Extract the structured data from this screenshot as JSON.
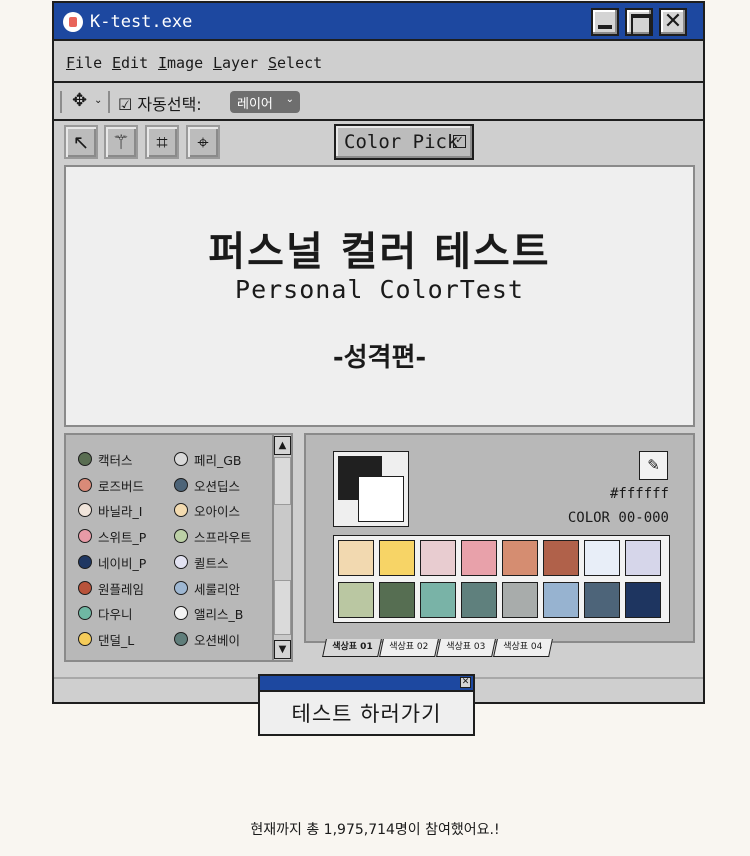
{
  "window": {
    "title": "K-test.exe",
    "close_glyph": "✕"
  },
  "menu": {
    "items": [
      "File",
      "Edit",
      "Image",
      "Layer",
      "Select"
    ]
  },
  "options": {
    "move_icon": "✥",
    "chevron": "⌄",
    "autoselect_label": "☑ 자동선택:",
    "layer_value": "레이어"
  },
  "toolbar": {
    "tools": [
      {
        "name": "pointer-icon",
        "glyph": "↖"
      },
      {
        "name": "magic-wand-icon",
        "glyph": "⚚"
      },
      {
        "name": "crop-icon",
        "glyph": "⌗"
      },
      {
        "name": "crosshair-icon",
        "glyph": "⌖"
      }
    ],
    "color_pick_label": "Color Pick",
    "color_pick_check": "✓"
  },
  "canvas": {
    "title": "퍼스널 컬러 테스트",
    "subtitle": "Personal ColorTest",
    "edition": "-성격편-"
  },
  "color_list": {
    "items": [
      {
        "label": "캑터스",
        "color": "#5a6e52"
      },
      {
        "label": "로즈버드",
        "color": "#d98a78"
      },
      {
        "label": "바닐라_I",
        "color": "#f0e4da"
      },
      {
        "label": "스위트_P",
        "color": "#e79aa6"
      },
      {
        "label": "네이비_P",
        "color": "#1f3762"
      },
      {
        "label": "원플레임",
        "color": "#b8533a"
      },
      {
        "label": "다우니",
        "color": "#6fb7a3"
      },
      {
        "label": "댄덜_L",
        "color": "#f5cc5a"
      },
      {
        "label": "페리_GB",
        "color": "#d9d9d9"
      },
      {
        "label": "오션딥스",
        "color": "#4d6478"
      },
      {
        "label": "오아이스",
        "color": "#f3dbb0"
      },
      {
        "label": "스프라우트",
        "color": "#bcd0a6"
      },
      {
        "label": "퀼트스",
        "color": "#e3e3f2"
      },
      {
        "label": "세룰리안",
        "color": "#9eb7d2"
      },
      {
        "label": "앨리스_B",
        "color": "#f4f4f4"
      },
      {
        "label": "오션베이",
        "color": "#607e7b"
      }
    ],
    "scroll_up": "▲",
    "scroll_down": "▼"
  },
  "color_panel": {
    "foreground": "#202020",
    "background": "#ffffff",
    "eyedropper_glyph": "✎",
    "hex": "#ffffff",
    "code": "COLOR 00-000",
    "swatches": [
      "#f2d9b0",
      "#f7d466",
      "#e8ccd0",
      "#e8a1aa",
      "#d58d71",
      "#b0614a",
      "#e8eef8",
      "#d6d6ea",
      "#bac7a2",
      "#566e52",
      "#79b3a7",
      "#5f807d",
      "#a8acab",
      "#97b3d0",
      "#4d6479",
      "#1e3560"
    ]
  },
  "tabs": [
    "색상표 01",
    "색상표 02",
    "색상표 03",
    "색상표 04"
  ],
  "start": {
    "label": "테스트 하러가기",
    "close_glyph": "✕"
  },
  "footer": {
    "participants": "현재까지 총 1,975,714명이 참여했어요.!"
  }
}
